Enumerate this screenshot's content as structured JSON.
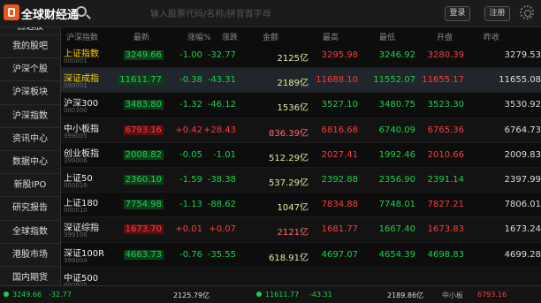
{
  "app": {
    "brand": "全球财经通",
    "search_placeholder": "输入股票代码/名称/拼音首字母",
    "btn_login": "登录",
    "btn_register": "注册"
  },
  "sidebar": {
    "items": [
      "自选股",
      "我的股吧",
      "沪深个股",
      "沪深板块",
      "沪深指数",
      "资讯中心",
      "数据中心",
      "新股IPO",
      "研究报告",
      "全球指数",
      "港股市场",
      "国内期货"
    ]
  },
  "table": {
    "headers": [
      "沪深指数",
      "最新",
      "涨幅%",
      "涨跌",
      "金额",
      "最高",
      "最低",
      "开盘",
      "昨收"
    ],
    "rows": [
      {
        "name": "上证指数",
        "code": "000001",
        "last": "3249.66",
        "pct": "-1.00",
        "chg": "-32.77",
        "amount": "2125亿",
        "high": "3295.98",
        "low": "3246.92",
        "open": "3280.39",
        "prev": "3279.53"
      },
      {
        "name": "深证成指",
        "code": "399001",
        "last": "11611.77",
        "pct": "-0.38",
        "chg": "-43.31",
        "amount": "2189亿",
        "high": "11688.10",
        "low": "11552.07",
        "open": "11655.17",
        "prev": "11655.08"
      },
      {
        "name": "沪深300",
        "code": "000300",
        "last": "3483.80",
        "pct": "-1.32",
        "chg": "-46.12",
        "amount": "1536亿",
        "high": "3527.10",
        "low": "3480.75",
        "open": "3523.30",
        "prev": "3530.92"
      },
      {
        "name": "中小板指",
        "code": "399005",
        "last": "6793.16",
        "pct": "+0.42",
        "chg": "+28.43",
        "amount": "836.39亿",
        "high": "6816.68",
        "low": "6740.09",
        "open": "6765.36",
        "prev": "6764.73"
      },
      {
        "name": "创业板指",
        "code": "399006",
        "last": "2008.82",
        "pct": "-0.05",
        "chg": "-1.01",
        "amount": "512.29亿",
        "high": "2027.41",
        "low": "1992.46",
        "open": "2010.66",
        "prev": "2009.83"
      },
      {
        "name": "上证50",
        "code": "000016",
        "last": "2360.10",
        "pct": "-1.59",
        "chg": "-38.38",
        "amount": "537.29亿",
        "high": "2392.88",
        "low": "2356.90",
        "open": "2391.14",
        "prev": "2397.99"
      },
      {
        "name": "上证180",
        "code": "000010",
        "last": "7754.98",
        "pct": "-1.13",
        "chg": "-88.62",
        "amount": "1047亿",
        "high": "7834.88",
        "low": "7748.01",
        "open": "7827.21",
        "prev": "7806.01"
      },
      {
        "name": "深证综指",
        "code": "399106",
        "last": "1673.70",
        "pct": "+0.01",
        "chg": "+0.07",
        "amount": "2121亿",
        "high": "1681.77",
        "low": "1667.40",
        "open": "1673.83",
        "prev": "1673.24"
      },
      {
        "name": "深证100R",
        "code": "399004",
        "last": "4663.73",
        "pct": "-0.76",
        "chg": "-35.55",
        "amount": "618.91亿",
        "high": "4697.07",
        "low": "4654.39",
        "open": "4698.83",
        "prev": "4699.28"
      },
      {
        "name": "中证500",
        "code": "000905",
        "last": "",
        "pct": "",
        "chg": "",
        "amount": "",
        "high": "",
        "low": "",
        "open": "",
        "prev": ""
      }
    ]
  },
  "status": {
    "sh_index": "3249.66",
    "sh_chg": "-32.77",
    "sh_amt": "2125.79亿",
    "sz_index": "11611.77",
    "sz_chg": "-43.31",
    "sz_amt": "2189.86亿",
    "time": "中小板",
    "extra": "6793.16"
  },
  "colors": {
    "up": "#ff3b3b",
    "down": "#19d24a",
    "flat": "#dddddd",
    "accent": "#e8591a"
  }
}
